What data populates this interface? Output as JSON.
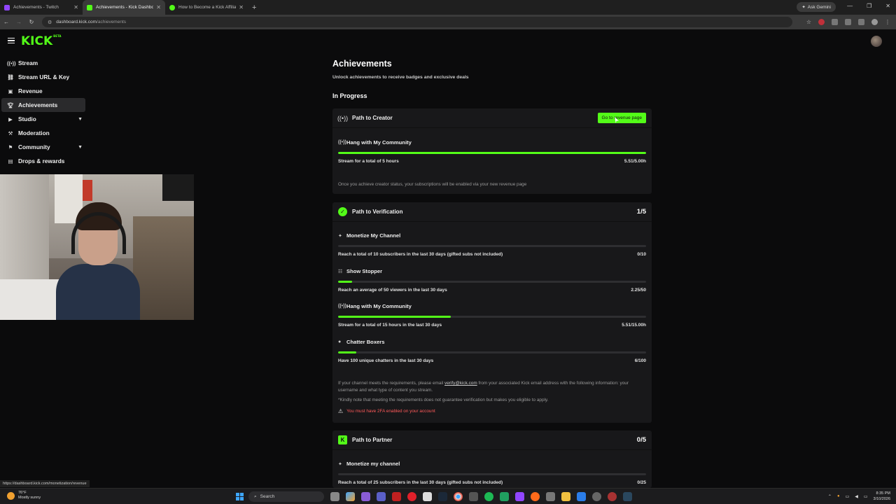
{
  "browser": {
    "tabs": [
      {
        "title": "Achievements - Twitch",
        "color": "#9146ff"
      },
      {
        "title": "Achievements - Kick Dashboard",
        "color": "#53fc18"
      },
      {
        "title": "How to Become a Kick Affiliate",
        "color": "#53fc18"
      }
    ],
    "gemini_label": "Ask Gemini",
    "url_domain": "dashboard.kick.com",
    "url_path": "/achievements"
  },
  "brand": {
    "logo": "KICK",
    "logo_sup": "BETA",
    "accent": "#53fc18"
  },
  "sidebar": {
    "items": [
      {
        "label": "Stream",
        "icon": "broadcast-icon"
      },
      {
        "label": "Stream URL & Key",
        "icon": "link-icon"
      },
      {
        "label": "Revenue",
        "icon": "revenue-icon"
      },
      {
        "label": "Achievements",
        "icon": "trophy-icon"
      },
      {
        "label": "Studio",
        "icon": "studio-icon"
      },
      {
        "label": "Moderation",
        "icon": "hammer-icon"
      },
      {
        "label": "Community",
        "icon": "community-icon"
      },
      {
        "label": "Drops & rewards",
        "icon": "gift-icon"
      }
    ]
  },
  "page": {
    "title": "Achievements",
    "subtitle": "Unlock achievements to receive badges and exclusive deals",
    "section": "In Progress"
  },
  "creator": {
    "title": "Path to Creator",
    "button": "Go to revenue page",
    "task": {
      "name": "Hang with My Community",
      "desc": "Stream for a total of 5 hours",
      "value": "5.51/5.00h",
      "progress": 1.0
    },
    "note": "Once you achieve creator status, your subscriptions will be enabled via your new revenue page"
  },
  "verification": {
    "title": "Path to Verification",
    "count": "1/5",
    "tasks": [
      {
        "name": "Monetize My Channel",
        "desc": "Reach a total of 10 subscribers in the last 30 days (gifted subs not included)",
        "value": "0/10",
        "progress": 0.0
      },
      {
        "name": "Show Stopper",
        "desc": "Reach an average of 50 viewers in the last 30 days",
        "value": "2.25/50",
        "progress": 0.045
      },
      {
        "name": "Hang with My Community",
        "desc": "Stream for a total of 15 hours in the last 30 days",
        "value": "5.51/15.00h",
        "progress": 0.367
      },
      {
        "name": "Chatter Boxers",
        "desc": "Have 100 unique chatters in the last 30 days",
        "value": "6/100",
        "progress": 0.06
      }
    ],
    "note_pre": "If your channel meets the requirements, please email",
    "note_email": "verify@kick.com",
    "note_post": "from your associated Kick email address with the following information: your username and what type of content you stream.",
    "note_star": "*Kindly note that meeting the requirements does not guarantee verification but makes you eligible to apply.",
    "warning": "You must have 2FA enabled on your account"
  },
  "partner": {
    "title": "Path to Partner",
    "count": "0/5",
    "task": {
      "name": "Monetize my channel",
      "desc": "Reach a total of 25 subscribers in the last 30 days (gifted subs not included)",
      "value": "0/25",
      "progress": 0.0
    }
  },
  "status_link": "https://dashboard.kick.com/monetization/revenue",
  "taskbar": {
    "temp": "76°F",
    "weather": "Mostly sunny",
    "search": "Search",
    "time": "8:35 PM",
    "date": "3/10/2026"
  }
}
